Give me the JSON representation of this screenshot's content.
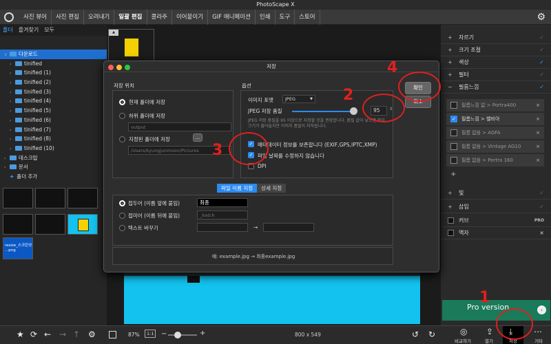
{
  "window": {
    "title": "PhotoScape X"
  },
  "menu": {
    "tabs": [
      "사진 뷰어",
      "사진 편집",
      "오려내기",
      "일괄 편집",
      "콜라주",
      "이어붙이기",
      "GIF 애니메이션",
      "인쇄",
      "도구",
      "스토어"
    ],
    "active": "일괄 편집"
  },
  "left": {
    "subtabs": [
      "폴더",
      "즐겨찾기",
      "모두"
    ],
    "tree": [
      {
        "label": "다운로드",
        "selected": true
      },
      {
        "label": "tinified"
      },
      {
        "label": "tinified (1)"
      },
      {
        "label": "tinified (2)"
      },
      {
        "label": "tinified (3)"
      },
      {
        "label": "tinified (4)"
      },
      {
        "label": "tinified (5)"
      },
      {
        "label": "tinified (6)"
      },
      {
        "label": "tinified (7)"
      },
      {
        "label": "tinified (8)"
      },
      {
        "label": "tinified (10)"
      },
      {
        "label": "데스크탑"
      },
      {
        "label": "문서"
      },
      {
        "label": "폴더 추가"
      }
    ],
    "thumb_caption": "resize_스크린샷 ...png"
  },
  "dialog": {
    "title": "저장",
    "save_location": {
      "heading": "저장 위치",
      "options": [
        "현재 폴더에 저장",
        "하위 폴더에 저장",
        "지정된 폴더에 저장"
      ],
      "subfolder_placeholder": "output",
      "folder_path": "/Users/kyungjunmoon/Pictures",
      "browse": "..."
    },
    "options": {
      "heading": "옵션",
      "image_format_label": "이미지 포맷",
      "image_format": "JPEG",
      "quality_label": "JPEG 저장 품질",
      "quality": "95",
      "quality_note": "JPEG 저장 품질을 95 이상으로 지정할 것을 권장합니다. 품질 값이 낮으면 파일 크기가 줄어들지만 이미지 품질이 저하됩니다.",
      "checks": [
        {
          "label": "메타데이터 정보를 보존합니다 (EXIF,GPS,IPTC,XMP)",
          "checked": true
        },
        {
          "label": "파일 날짜를 수정하지 않습니다",
          "checked": true
        },
        {
          "label": "DPI",
          "checked": false
        }
      ]
    },
    "ok": "확인",
    "cancel": "취소",
    "filename_tabs": [
      "파일 이름 지정",
      "상세 지정"
    ],
    "filename": {
      "prefix_label": "접두어 (이름 앞에 붙임)",
      "prefix_value": "최종",
      "suffix_label": "접미어 (이름 뒤에 붙임)",
      "suffix_placeholder": "_batch",
      "replace_label": "텍스트 바꾸기",
      "arrow": "→",
      "example": "예: example.jpg → 최종example.jpg"
    }
  },
  "right": {
    "items": [
      {
        "label": "자르기",
        "pm": "+",
        "checked": false
      },
      {
        "label": "크기 조절",
        "pm": "+",
        "checked": false
      },
      {
        "label": "색상",
        "pm": "+",
        "checked": true
      },
      {
        "label": "필터",
        "pm": "+",
        "checked": false
      },
      {
        "label": "필름느낌",
        "pm": "−",
        "checked": true
      }
    ],
    "film_rows": [
      {
        "label": "필름느낌 없 > Portra400",
        "on": false
      },
      {
        "label": "필름느낌 > 벨비아",
        "on": true
      },
      {
        "label": "필름 없음 > AGFA",
        "on": false
      },
      {
        "label": "필름 없음 > Vintage AG10",
        "on": false
      },
      {
        "label": "필름 없음 > Portra 160",
        "on": false
      }
    ],
    "add": "+",
    "lower_items": [
      {
        "label": "빛",
        "pm": "+"
      },
      {
        "label": "삽입",
        "pm": "+"
      },
      {
        "label": "커브",
        "badge": "PRO"
      },
      {
        "label": "액자",
        "badge": "×"
      }
    ],
    "promo": "Pro version"
  },
  "bottom": {
    "zoom": "87%",
    "ratio": "1:1",
    "dimensions": "800 x 549",
    "buttons": [
      "비교하기",
      "열기",
      "저장",
      "기타"
    ]
  },
  "annotations": [
    "1",
    "2",
    "3",
    "4"
  ]
}
